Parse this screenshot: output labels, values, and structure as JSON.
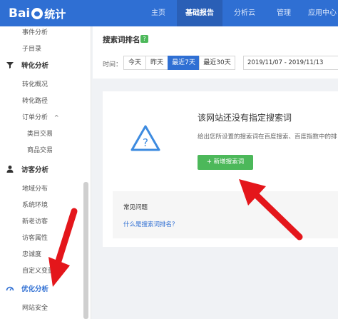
{
  "header": {
    "logo": {
      "text_left": "Bai",
      "paw": "du",
      "text_right": "统计"
    },
    "nav": [
      "主页",
      "基础报告",
      "分析云",
      "管理",
      "应用中心"
    ],
    "active_nav": "基础报告",
    "colors": {
      "bar": "#2f6fd3",
      "active": "#2a5fb6"
    }
  },
  "sidebar": {
    "top_items": [
      "事件分析",
      "子目录"
    ],
    "conversion_group": "转化分析",
    "conversion_items": [
      "转化概况",
      "转化路径"
    ],
    "orders": {
      "label": "订单分析",
      "caret": "^"
    },
    "order_items": [
      "类目交易",
      "商品交易"
    ],
    "visitor_group": "访客分析",
    "visitor_items": [
      "地域分布",
      "系统环境",
      "新老访客",
      "访客属性",
      "忠诚度",
      "自定义变量"
    ],
    "optimize_group": "优化分析",
    "optimize_items": [
      "网站安全"
    ],
    "icons": [
      "funnel-icon",
      "person-icon",
      "gauge-icon"
    ]
  },
  "toolbar": {
    "title": "搜索词排名",
    "help": "?",
    "time_label": "时间：",
    "time_buttons": [
      "今天",
      "昨天",
      "最近7天",
      "最近30天"
    ],
    "active_time": "最近7天",
    "date_range": "2019/11/07 - 2019/11/13"
  },
  "empty_state": {
    "title": "该网站还没有指定搜索词",
    "description": "给出您所设置的搜索词在百度搜索、百度指数中的排",
    "button": "+ 新增搜索词",
    "icon": "warning-icon"
  },
  "faq": {
    "title": "常见问题",
    "link": "什么是搜索词排名？"
  },
  "colors": {
    "accent": "#2f6fd3",
    "button_green": "#4cb85a",
    "annotation_red": "#e4161b"
  }
}
